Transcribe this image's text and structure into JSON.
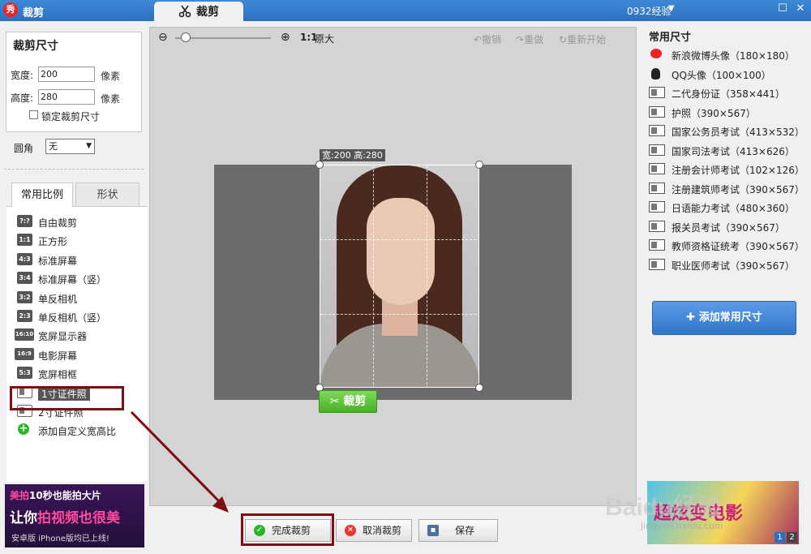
{
  "app": {
    "title": "裁剪",
    "logo_char": "秀",
    "tab_label": "裁剪",
    "user": "0932经验"
  },
  "crop_size": {
    "title": "裁剪尺寸",
    "width_label": "宽度:",
    "width_value": "200",
    "height_label": "高度:",
    "height_value": "280",
    "unit": "像素",
    "lock_label": "锁定裁剪尺寸",
    "corner_label": "圆角",
    "corner_value": "无"
  },
  "tabs": [
    {
      "label": "常用比例"
    },
    {
      "label": "形状"
    }
  ],
  "ratios": [
    {
      "icon": "?:?",
      "label": "自由裁剪"
    },
    {
      "icon": "1:1",
      "label": "正方形"
    },
    {
      "icon": "4:3",
      "label": "标准屏幕"
    },
    {
      "icon": "3:4",
      "label": "标准屏幕（竖）"
    },
    {
      "icon": "3:2",
      "label": "单反相机"
    },
    {
      "icon": "2:3",
      "label": "单反相机（竖）"
    },
    {
      "icon": "16:10",
      "label": "宽屏显示器"
    },
    {
      "icon": "16:9",
      "label": "电影屏幕"
    },
    {
      "icon": "5:3",
      "label": "宽屏相框"
    },
    {
      "icon": "card",
      "label": "1寸证件照"
    },
    {
      "icon": "card",
      "label": "2寸证件照"
    },
    {
      "icon": "+",
      "label": "添加自定义宽高比"
    }
  ],
  "selected_ratio_index": 9,
  "ad_left": {
    "line1_a": "美拍",
    "line1_b": "10秒也能拍大片",
    "line2_a": "让你",
    "line2_b": "拍视频也很美",
    "line3": "安卓版  iPhone版均已上线!"
  },
  "toolbar": {
    "zoom_ratio": "1:1",
    "zoom_orig": "原大",
    "undo": "撤销",
    "redo": "重做",
    "restart": "重新开始"
  },
  "zoom_level": 0.08,
  "crop_overlay": {
    "dim_text": "宽:200 高:280",
    "crop_button": "裁剪"
  },
  "bottom_buttons": {
    "finish": "完成裁剪",
    "cancel": "取消裁剪",
    "save": "保存"
  },
  "common_sizes": {
    "title": "常用尺寸",
    "items": [
      {
        "icon": "weibo-icon",
        "label": "新浪微博头像（180×180）"
      },
      {
        "icon": "qq-icon",
        "label": "QQ头像（100×100）"
      },
      {
        "icon": "id-card-icon",
        "label": "二代身份证（358×441）"
      },
      {
        "icon": "id-card-icon",
        "label": "护照（390×567）"
      },
      {
        "icon": "id-card-icon",
        "label": "国家公务员考试（413×532）"
      },
      {
        "icon": "id-card-icon",
        "label": "国家司法考试（413×626）"
      },
      {
        "icon": "id-card-icon",
        "label": "注册会计师考试（102×126）"
      },
      {
        "icon": "id-card-icon",
        "label": "注册建筑师考试（390×567）"
      },
      {
        "icon": "id-card-icon",
        "label": "日语能力考试（480×360）"
      },
      {
        "icon": "id-card-icon",
        "label": "报关员考试（390×567）"
      },
      {
        "icon": "id-card-icon",
        "label": "教师资格证统考（390×567）"
      },
      {
        "icon": "id-card-icon",
        "label": "职业医师考试（390×567）"
      }
    ],
    "add_button": "添加常用尺寸"
  },
  "ad_right": {
    "text": "超炫变电影",
    "pages": [
      "1",
      "2"
    ]
  },
  "watermark": {
    "main": "Baidu经验",
    "sub": "jingyan.baidu.com"
  },
  "colors": {
    "titlebar": "#2d6fbe",
    "highlight_box": "#7b0f12",
    "accent_green": "#48b028",
    "add_btn": "#2f76c9"
  }
}
